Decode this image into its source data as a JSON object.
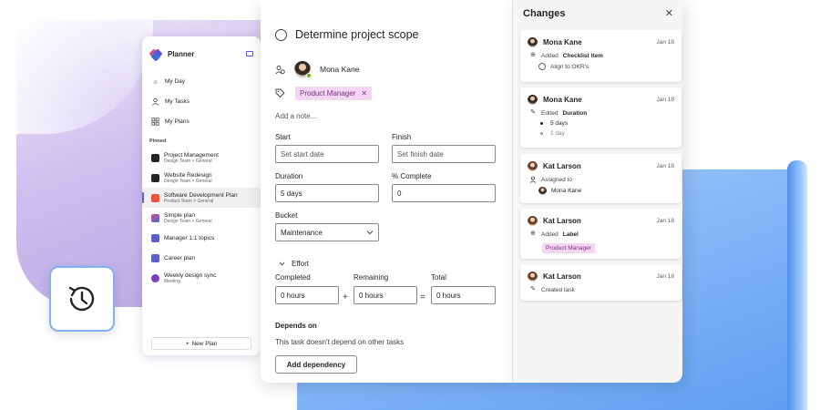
{
  "sidebar": {
    "app_title": "Planner",
    "nav": [
      {
        "label": "My Day",
        "icon": "sun-icon"
      },
      {
        "label": "My Tasks",
        "icon": "person-icon"
      },
      {
        "label": "My Plans",
        "icon": "grid-icon"
      }
    ],
    "pinned_label": "Pinned",
    "plans": [
      {
        "name": "Project Management",
        "sub": "Design Team > General",
        "color": "#242424"
      },
      {
        "name": "Website Redesign",
        "sub": "Design Team > General",
        "color": "#242424"
      },
      {
        "name": "Software Development Plan",
        "sub": "Product Team > General",
        "color": "#e8553e"
      },
      {
        "name": "Simple plan",
        "sub": "Design Team > General",
        "color": "#3b6fd6"
      },
      {
        "name": "Manager 1:1 topics",
        "sub": "",
        "color": "#5b5fc7"
      },
      {
        "name": "Career plan",
        "sub": "",
        "color": "#5b5fc7"
      },
      {
        "name": "Weekly design sync",
        "sub": "Meeting",
        "color": "#7b3fc4"
      }
    ],
    "new_plan_label": "New Plan"
  },
  "task": {
    "title": "Determine project scope",
    "assignee": "Mona Kane",
    "label": "Product Manager",
    "note_placeholder": "Add a note...",
    "start_label": "Start",
    "start_placeholder": "Set start date",
    "finish_label": "Finish",
    "finish_placeholder": "Set finish date",
    "duration_label": "Duration",
    "duration_value": "5 days",
    "complete_label": "% Complete",
    "complete_value": "0",
    "bucket_label": "Bucket",
    "bucket_value": "Maintenance",
    "effort_label": "Effort",
    "completed_label": "Completed",
    "completed_value": "0 hours",
    "remaining_label": "Remaining",
    "remaining_value": "0 hours",
    "total_label": "Total",
    "total_value": "0 hours",
    "plus": "+",
    "equals": "=",
    "depends_label": "Depends on",
    "depends_text": "This task doesn't depend on other tasks",
    "add_dependency_label": "Add dependency"
  },
  "changes": {
    "title": "Changes",
    "cards": [
      {
        "name": "Mona Kane",
        "date": "Jan 18",
        "action": "Added",
        "target": "Checklist item",
        "detail": "Align to OKR's"
      },
      {
        "name": "Mona Kane",
        "date": "Jan 18",
        "action": "Edited",
        "target": "Duration",
        "new_value": "5 days",
        "old_value": "1 day"
      },
      {
        "name": "Kat Larson",
        "date": "Jan 18",
        "action": "Assigned to",
        "detail": "Mona Kane"
      },
      {
        "name": "Kat Larson",
        "date": "Jan 18",
        "action": "Added",
        "target": "Label",
        "detail": "Product Manager"
      },
      {
        "name": "Kat Larson",
        "date": "Jan 18",
        "action": "Created task"
      }
    ]
  },
  "colors": {
    "accent": "#5b5fc7",
    "label_bg": "#f3d6f3",
    "label_text": "#7b2e7a",
    "presence_available": "#6bb700"
  }
}
